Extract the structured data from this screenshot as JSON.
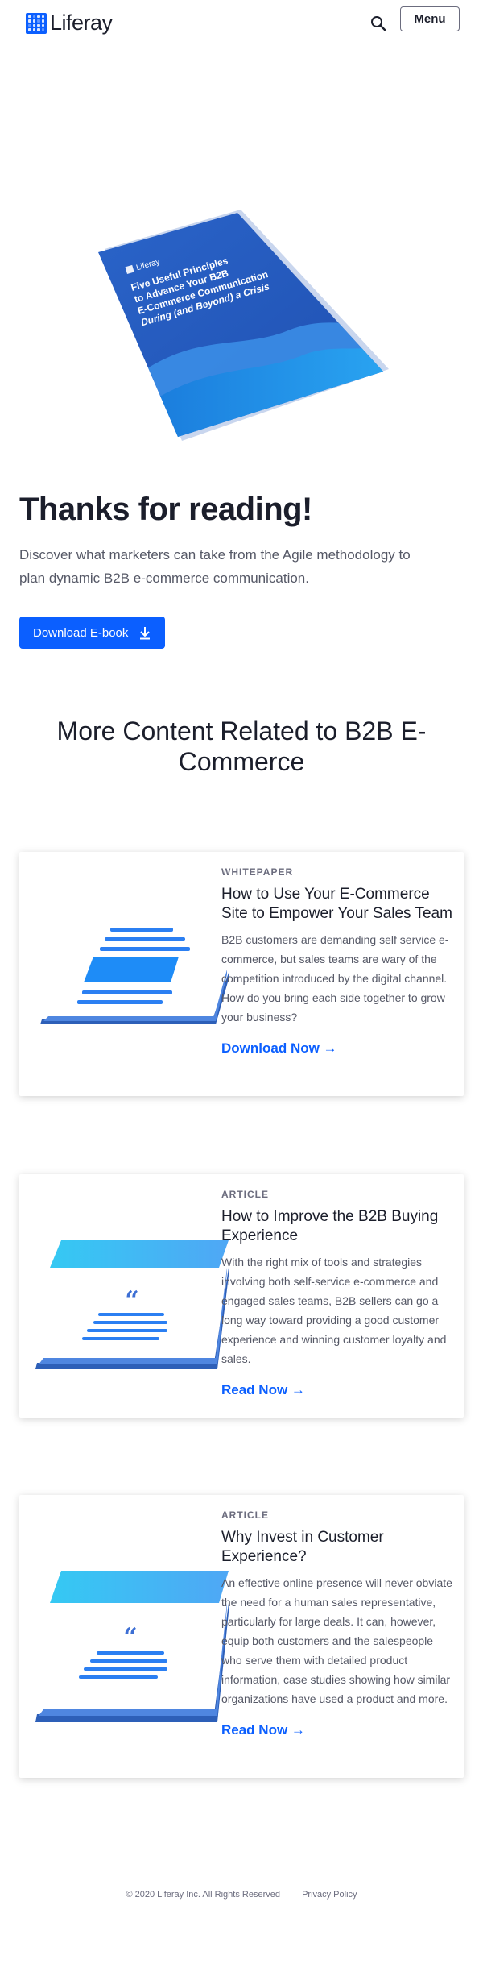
{
  "header": {
    "logo_text": "Liferay",
    "menu_label": "Menu"
  },
  "hero": {
    "booklet_brand": "Liferay",
    "booklet_title_lines": [
      "Five Useful Principles",
      "to Advance Your B2B",
      "E-Commerce Communication",
      "During (and Beyond) a Crisis"
    ],
    "title": "Thanks for reading!",
    "description": "Discover what marketers can take from the Agile methodology to plan dynamic B2B e-commerce communication.",
    "download_label": "Download E-book"
  },
  "related": {
    "title": "More Content Related to B2B E-Commerce",
    "cards": [
      {
        "kicker": "WHITEPAPER",
        "title": "How to Use Your E-Commerce Site to Empower Your Sales Team",
        "text": "B2B customers are demanding self service e-commerce, but sales teams are wary of the competition introduced by the digital channel.  How do you bring each side together to grow your business?",
        "link": "Download Now →",
        "art": "document-illustration"
      },
      {
        "kicker": "ARTICLE",
        "title": "How to Improve the B2B Buying Experience",
        "text": "With the right mix of tools and strategies involving both self-service e-commerce and engaged sales teams, B2B sellers can go a long way toward providing a good customer experience and winning customer loyalty and sales.",
        "link": "Read Now →",
        "art": "quote-illustration"
      },
      {
        "kicker": "ARTICLE",
        "title": "Why Invest in Customer Experience?",
        "text": "An effective online presence will never obviate the need for a human sales representative, particularly for large deals. It can, however, equip both customers and the salespeople who serve them with detailed product information, case studies showing how similar organizations have used a product and more.",
        "link": "Read Now →",
        "art": "quote-illustration"
      }
    ]
  },
  "footer": {
    "copyright": "© 2020 Liferay Inc. All Rights Reserved",
    "privacy": "Privacy Policy"
  },
  "colors": {
    "accent": "#0b5fff",
    "text": "#1b1e2b",
    "muted": "#555866"
  }
}
